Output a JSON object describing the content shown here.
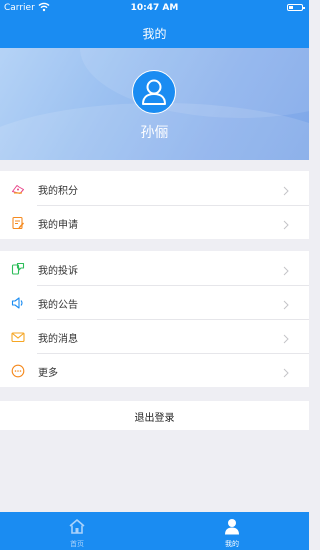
{
  "status_bar": {
    "carrier": "Carrier",
    "time": "10:47 AM"
  },
  "nav": {
    "title": "我的"
  },
  "profile": {
    "user_name": "孙俪"
  },
  "menu_group1": [
    {
      "label": "我的积分",
      "icon": "points-icon"
    },
    {
      "label": "我的申请",
      "icon": "application-icon"
    }
  ],
  "menu_group2": [
    {
      "label": "我的投诉",
      "icon": "complaint-icon"
    },
    {
      "label": "我的公告",
      "icon": "announcement-icon"
    },
    {
      "label": "我的消息",
      "icon": "message-icon"
    },
    {
      "label": "更多",
      "icon": "more-icon"
    }
  ],
  "logout": {
    "label": "退出登录"
  },
  "tab_bar": {
    "tabs": [
      {
        "label": "首页",
        "icon": "home-icon",
        "active": false
      },
      {
        "label": "我的",
        "icon": "user-icon",
        "active": true
      }
    ]
  },
  "colors": {
    "brand": "#1a8cf2",
    "tab_active": "#ffffff",
    "tab_inactive": "#a9d2fb"
  }
}
